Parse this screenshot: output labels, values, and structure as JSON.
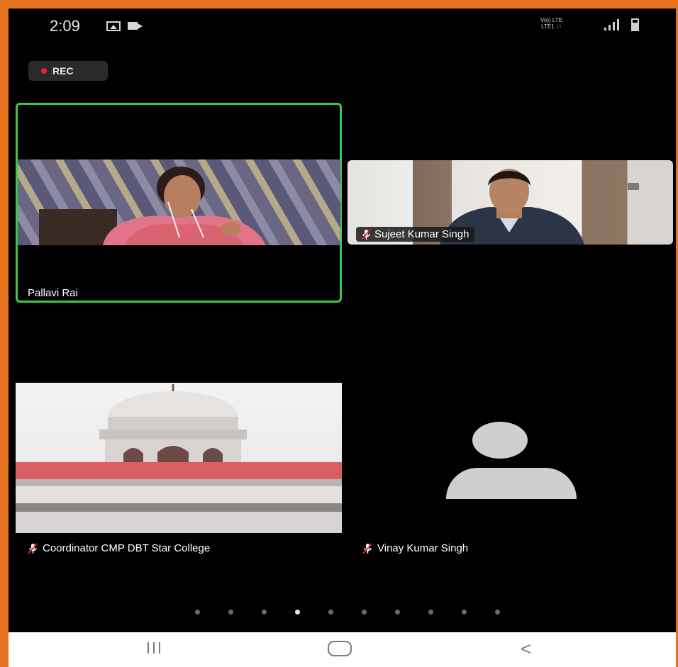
{
  "status_bar": {
    "time": "2:09",
    "network_line1": "Vo)) LTE",
    "network_line2": "LTE1 ↓↑",
    "icons": [
      "gallery-icon",
      "video-icon",
      "signal-icon",
      "battery-icon"
    ]
  },
  "recording": {
    "label": "REC",
    "color": "#e52424"
  },
  "participants": [
    {
      "name": "Pallavi Rai",
      "video": true,
      "active_speaker": true,
      "muted": false
    },
    {
      "name": "Sujeet Kumar Singh",
      "video": true,
      "active_speaker": false,
      "muted": true
    },
    {
      "name": "Coordinator CMP DBT Star College",
      "video": true,
      "active_speaker": false,
      "muted": true
    },
    {
      "name": "Vinay Kumar Singh",
      "video": false,
      "active_speaker": false,
      "muted": true
    }
  ],
  "pagination": {
    "total_pages": 10,
    "current_page": 4
  },
  "nav_bar": {
    "icons": [
      "recents-icon",
      "home-icon",
      "back-icon"
    ],
    "back_glyph": "<"
  },
  "colors": {
    "active_speaker_border": "#3cc94a",
    "frame": "#e8731e",
    "background": "#000000"
  }
}
